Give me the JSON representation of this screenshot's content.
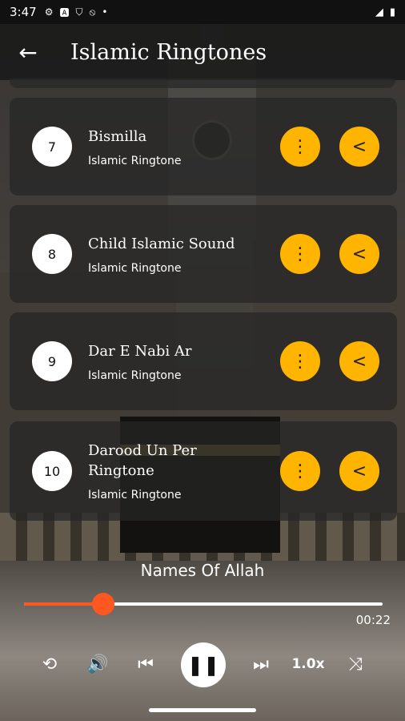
{
  "status": {
    "time": "3:47"
  },
  "appbar": {
    "title": "Islamic Ringtones",
    "back_icon": "arrow-left-icon"
  },
  "ringtones": [
    {
      "number": "7",
      "name": "Bismilla",
      "category": "Islamic Ringtone"
    },
    {
      "number": "8",
      "name": "Child Islamic Sound",
      "category": "Islamic Ringtone"
    },
    {
      "number": "9",
      "name": "Dar E Nabi Ar",
      "category": "Islamic Ringtone"
    },
    {
      "number": "10",
      "name": "Darood Un Per Ringtone",
      "category": "Islamic Ringtone"
    }
  ],
  "player": {
    "now_playing": "Names Of Allah",
    "elapsed": "00:22",
    "progress": 0.22,
    "speed": "1.0x"
  },
  "colors": {
    "accent": "#ffb400",
    "progress": "#ff5722"
  }
}
